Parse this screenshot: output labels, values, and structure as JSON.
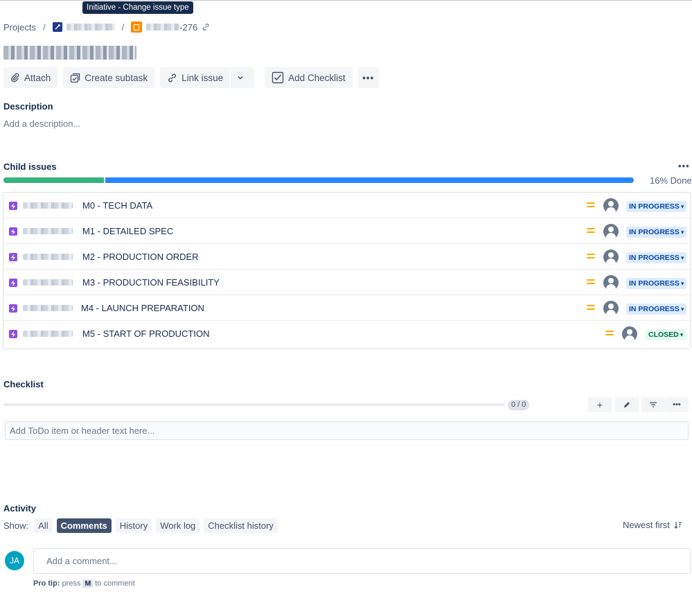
{
  "tooltip": "Initiative - Change issue type",
  "breadcrumb": {
    "projects": "Projects",
    "separator": "/",
    "issue_key_suffix": "-276"
  },
  "toolbar": {
    "attach": "Attach",
    "create_subtask": "Create subtask",
    "link_issue": "Link issue",
    "add_checklist": "Add Checklist",
    "more": "•••"
  },
  "description": {
    "heading": "Description",
    "placeholder": "Add a description..."
  },
  "child_issues": {
    "heading": "Child issues",
    "more": "•••",
    "progress_done_fraction": 0.16,
    "progress_label": "16% Done",
    "items": [
      {
        "summary": "M0 - TECH DATA",
        "status": "IN PROGRESS",
        "status_type": "inprog"
      },
      {
        "summary": "M1 - DETAILED SPEC",
        "status": "IN PROGRESS",
        "status_type": "inprog"
      },
      {
        "summary": "M2 - PRODUCTION ORDER",
        "status": "IN PROGRESS",
        "status_type": "inprog"
      },
      {
        "summary": "M3 - PRODUCTION FEASIBILITY",
        "status": "IN PROGRESS",
        "status_type": "inprog"
      },
      {
        "summary": "M4 - LAUNCH PREPARATION",
        "status": "IN PROGRESS",
        "status_type": "inprog"
      },
      {
        "summary": "M5 - START OF PRODUCTION",
        "status": "CLOSED",
        "status_type": "closed"
      }
    ]
  },
  "checklist": {
    "heading": "Checklist",
    "count": "0 / 0",
    "add_icon": "+",
    "more_icon": "•••",
    "input_placeholder": "Add ToDo item or header text here..."
  },
  "activity": {
    "heading": "Activity",
    "show_label": "Show:",
    "filters": [
      "All",
      "Comments",
      "History",
      "Work log",
      "Checklist history"
    ],
    "active_filter": "Comments",
    "sort": "Newest first",
    "user_initials": "JA",
    "comment_placeholder": "Add a comment...",
    "protip_label": "Pro tip:",
    "protip_press": "press",
    "protip_key": "M",
    "protip_tail": "to comment"
  },
  "colors": {
    "done": "#36b37e",
    "in_progress_bar": "#2684ff",
    "epic": "#904ee2",
    "priority_medium": "#ffab00",
    "avatar": "#00a3bf"
  }
}
